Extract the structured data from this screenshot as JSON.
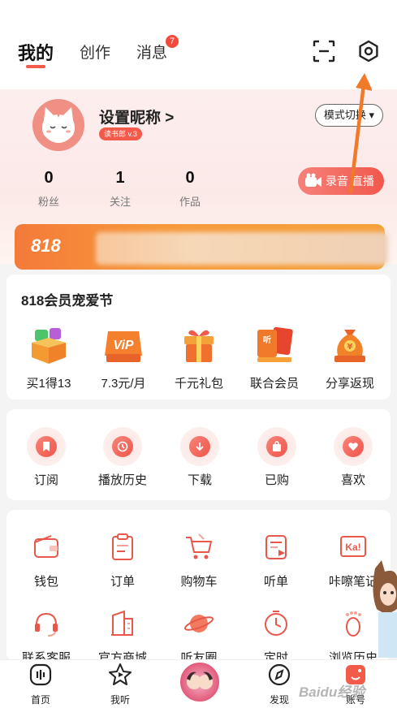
{
  "header": {
    "tabs": [
      {
        "label": "我的",
        "active": true
      },
      {
        "label": "创作",
        "active": false
      },
      {
        "label": "消息",
        "active": false,
        "badge": "7"
      }
    ],
    "icons": [
      "scan-icon",
      "settings-icon"
    ]
  },
  "profile": {
    "nickname": "设置昵称 >",
    "level": "读书郎 v.3",
    "mode_button": "模式切换 ▾",
    "stats": [
      {
        "value": "0",
        "label": "粉丝"
      },
      {
        "value": "1",
        "label": "关注"
      },
      {
        "value": "0",
        "label": "作品"
      }
    ],
    "record_button": "录音 直播",
    "banner_text": "818"
  },
  "promo": {
    "title": "818会员宠爱节",
    "items": [
      {
        "label": "买1得13",
        "icon": "gift-box-icon"
      },
      {
        "label": "7.3元/月",
        "icon": "vip-icon"
      },
      {
        "label": "千元礼包",
        "icon": "gift-package-icon"
      },
      {
        "label": "联合会员",
        "icon": "joint-member-icon"
      },
      {
        "label": "分享返现",
        "icon": "money-bag-icon"
      }
    ]
  },
  "quick": {
    "items": [
      {
        "label": "订阅",
        "icon": "bookmark-icon"
      },
      {
        "label": "播放历史",
        "icon": "clock-icon"
      },
      {
        "label": "下载",
        "icon": "download-icon"
      },
      {
        "label": "已购",
        "icon": "bag-icon"
      },
      {
        "label": "喜欢",
        "icon": "heart-icon"
      }
    ]
  },
  "services": {
    "row1": [
      {
        "label": "钱包",
        "icon": "wallet-icon"
      },
      {
        "label": "订单",
        "icon": "order-icon"
      },
      {
        "label": "购物车",
        "icon": "cart-icon"
      },
      {
        "label": "听单",
        "icon": "playlist-icon"
      },
      {
        "label": "咔嚓笔记",
        "icon": "note-icon"
      }
    ],
    "row2": [
      {
        "label": "联系客服",
        "icon": "headset-icon"
      },
      {
        "label": "官方商城",
        "icon": "store-icon"
      },
      {
        "label": "听友圈",
        "icon": "planet-icon"
      },
      {
        "label": "定时",
        "icon": "timer-icon"
      },
      {
        "label": "浏览历史",
        "icon": "footprint-icon"
      }
    ]
  },
  "bottom_nav": [
    {
      "label": "首页",
      "icon": "home-icon"
    },
    {
      "label": "我听",
      "icon": "play-star-icon"
    },
    {
      "label": "",
      "icon": "center-avatar"
    },
    {
      "label": "发现",
      "icon": "discover-icon"
    },
    {
      "label": "账号",
      "icon": "account-icon"
    }
  ],
  "watermark": "Baidu经验",
  "colors": {
    "accent": "#f25a4a",
    "arrow": "#f07a2a"
  }
}
